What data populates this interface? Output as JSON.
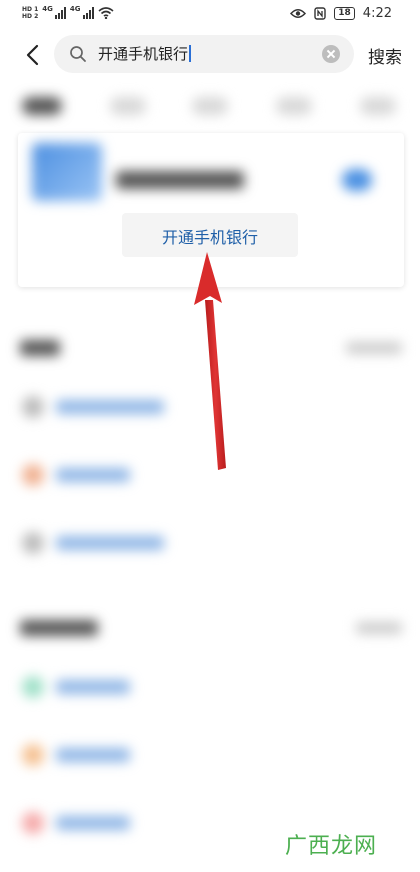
{
  "status_bar": {
    "hd1": "HD 1",
    "hd2": "HD 2",
    "net1": "4G",
    "net2": "4G",
    "battery": "18",
    "time": "4:22"
  },
  "search": {
    "query": "开通手机银行",
    "button_label": "搜索"
  },
  "suggestion": {
    "label": "开通手机银行"
  },
  "watermark": "广西龙网",
  "colors": {
    "accent_link": "#1f5fa8",
    "arrow": "#d92b2b"
  }
}
